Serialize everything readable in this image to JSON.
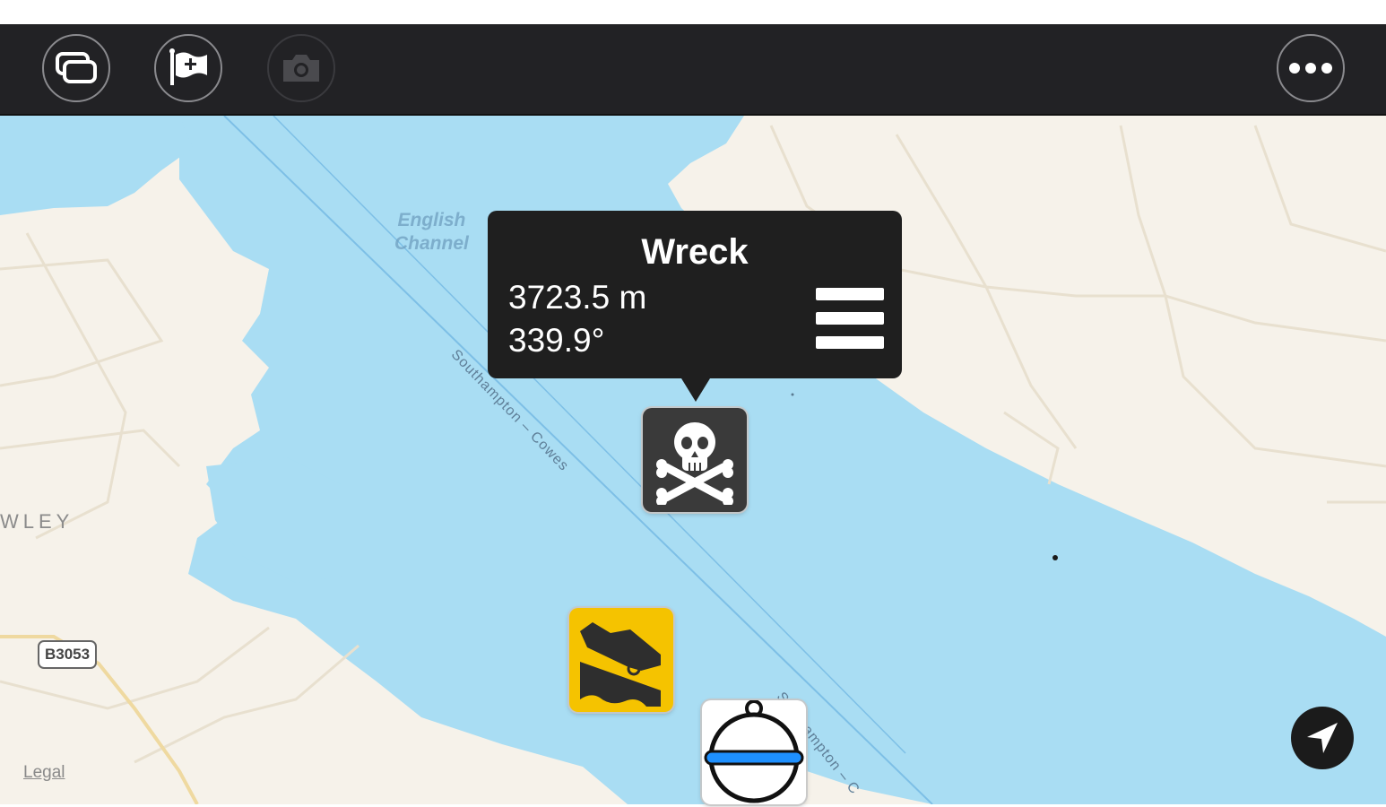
{
  "toolbar": {
    "buttons": [
      {
        "name": "layers",
        "icon": "layers-icon",
        "enabled": true
      },
      {
        "name": "add-waypoint",
        "icon": "flag-add-icon",
        "enabled": true
      },
      {
        "name": "camera",
        "icon": "camera-icon",
        "enabled": false
      }
    ],
    "more_icon": "ellipsis-icon"
  },
  "map": {
    "water_label": "English\nChannel",
    "route_label_1": "Southampton – Cowes",
    "route_label_2": "Southampton – C",
    "area_label": "WLEY",
    "road_shield": "B3053",
    "legal": "Legal",
    "colors": {
      "water": "#a9ddf3",
      "land": "#f6f2ea",
      "road": "#ece4d4"
    }
  },
  "callout": {
    "title": "Wreck",
    "distance": "3723.5 m",
    "bearing": "339.9°",
    "menu_icon": "menu-icon"
  },
  "markers": [
    {
      "name": "wreck-marker",
      "icon": "skull-crossbones-icon",
      "background": "#3a3a3a"
    },
    {
      "name": "slipway-marker",
      "icon": "slipway-icon",
      "background": "#f5c300"
    },
    {
      "name": "mooring-buoy-marker",
      "icon": "buoy-icon",
      "background": "#ffffff"
    }
  ],
  "locate_icon": "location-arrow-icon"
}
